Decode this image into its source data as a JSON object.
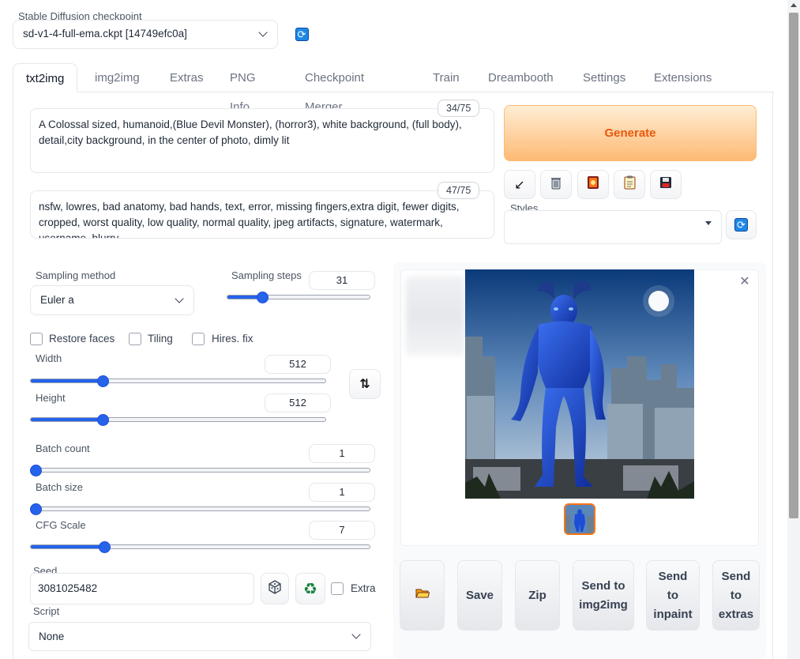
{
  "checkpoint": {
    "label": "Stable Diffusion checkpoint",
    "value": "sd-v1-4-full-ema.ckpt [14749efc0a]"
  },
  "tabs": [
    {
      "label": "txt2img"
    },
    {
      "label": "img2img"
    },
    {
      "label": "Extras"
    },
    {
      "label": "PNG Info"
    },
    {
      "label": "Checkpoint Merger"
    },
    {
      "label": "Train"
    },
    {
      "label": "Dreambooth"
    },
    {
      "label": "Settings"
    },
    {
      "label": "Extensions"
    }
  ],
  "prompt": {
    "text": "A Colossal sized, humanoid,(Blue Devil Monster), (horror3), white background, (full body), detail,city background, in the center of photo, dimly lit",
    "counter": "34/75"
  },
  "negative_prompt": {
    "text": "nsfw, lowres, bad anatomy, bad hands, text, error, missing fingers,extra digit, fewer digits, cropped, worst quality, low quality, normal quality, jpeg artifacts, signature, watermark, username, blurry",
    "counter": "47/75"
  },
  "generate_label": "Generate",
  "toolbar_icons": [
    "arrow-icon",
    "trash-icon",
    "art-icon",
    "clipboard-icon",
    "save-icon"
  ],
  "styles": {
    "label": "Styles",
    "value": ""
  },
  "sampling_method": {
    "label": "Sampling method",
    "value": "Euler a"
  },
  "sampling_steps": {
    "label": "Sampling steps",
    "value": "31",
    "fraction": 0.23
  },
  "checkboxes": [
    {
      "label": "Restore faces",
      "checked": false
    },
    {
      "label": "Tiling",
      "checked": false
    },
    {
      "label": "Hires. fix",
      "checked": false
    }
  ],
  "width": {
    "label": "Width",
    "value": "512",
    "fraction": 0.235
  },
  "height": {
    "label": "Height",
    "value": "512",
    "fraction": 0.235
  },
  "batch_count": {
    "label": "Batch count",
    "value": "1",
    "fraction": 0.0
  },
  "batch_size": {
    "label": "Batch size",
    "value": "1",
    "fraction": 0.0
  },
  "cfg_scale": {
    "label": "CFG Scale",
    "value": "7",
    "fraction": 0.21
  },
  "seed": {
    "label": "Seed",
    "value": "3081025482",
    "extra_label": "Extra"
  },
  "script": {
    "label": "Script",
    "value": "None"
  },
  "actions": [
    {
      "label": "",
      "icon": "folder-icon"
    },
    {
      "label": "Save"
    },
    {
      "label": "Zip"
    },
    {
      "label": "Send to img2img"
    },
    {
      "label": "Send to inpaint"
    },
    {
      "label": "Send to extras"
    }
  ],
  "colors": {
    "accent": "#2563eb",
    "generate_text": "#ea580c",
    "generate_bg": "#fdba74",
    "monster": "#1d4ed8"
  }
}
